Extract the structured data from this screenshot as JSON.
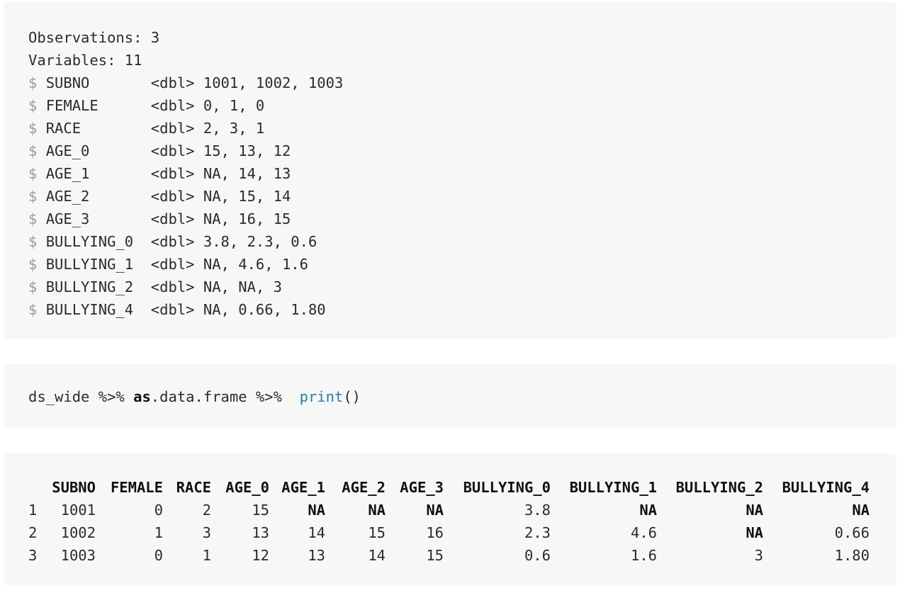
{
  "glimpse": {
    "observations": "Observations: 3",
    "variables": "Variables: 11",
    "rows": [
      {
        "name": "SUBNO      ",
        "type": "<dbl>",
        "values": "1001, 1002, 1003"
      },
      {
        "name": "FEMALE     ",
        "type": "<dbl>",
        "values": "0, 1, 0"
      },
      {
        "name": "RACE       ",
        "type": "<dbl>",
        "values": "2, 3, 1"
      },
      {
        "name": "AGE_0      ",
        "type": "<dbl>",
        "values": "15, 13, 12"
      },
      {
        "name": "AGE_1      ",
        "type": "<dbl>",
        "values": "NA, 14, 13"
      },
      {
        "name": "AGE_2      ",
        "type": "<dbl>",
        "values": "NA, 15, 14"
      },
      {
        "name": "AGE_3      ",
        "type": "<dbl>",
        "values": "NA, 16, 15"
      },
      {
        "name": "BULLYING_0 ",
        "type": "<dbl>",
        "values": "3.8, 2.3, 0.6"
      },
      {
        "name": "BULLYING_1 ",
        "type": "<dbl>",
        "values": "NA, 4.6, 1.6"
      },
      {
        "name": "BULLYING_2 ",
        "type": "<dbl>",
        "values": "NA, NA, 3"
      },
      {
        "name": "BULLYING_4 ",
        "type": "<dbl>",
        "values": "NA, 0.66, 1.80"
      }
    ]
  },
  "code": {
    "prefix": "ds_wide %>% ",
    "keyword": "as",
    "middle": ".data.frame %>%  ",
    "function": "print",
    "suffix": "()"
  },
  "table": {
    "columns": [
      "SUBNO",
      "FEMALE",
      "RACE",
      "AGE_0",
      "AGE_1",
      "AGE_2",
      "AGE_3",
      "BULLYING_0",
      "BULLYING_1",
      "BULLYING_2",
      "BULLYING_4"
    ],
    "rows": [
      {
        "index": "1",
        "cells": [
          "1001",
          "0",
          "2",
          "15",
          "NA",
          "NA",
          "NA",
          "3.8",
          "NA",
          "NA",
          "NA"
        ]
      },
      {
        "index": "2",
        "cells": [
          "1002",
          "1",
          "3",
          "13",
          "14",
          "15",
          "16",
          "2.3",
          "4.6",
          "NA",
          "0.66"
        ]
      },
      {
        "index": "3",
        "cells": [
          "1003",
          "0",
          "1",
          "12",
          "13",
          "14",
          "15",
          "0.6",
          "1.6",
          "3",
          "1.80"
        ]
      }
    ]
  }
}
